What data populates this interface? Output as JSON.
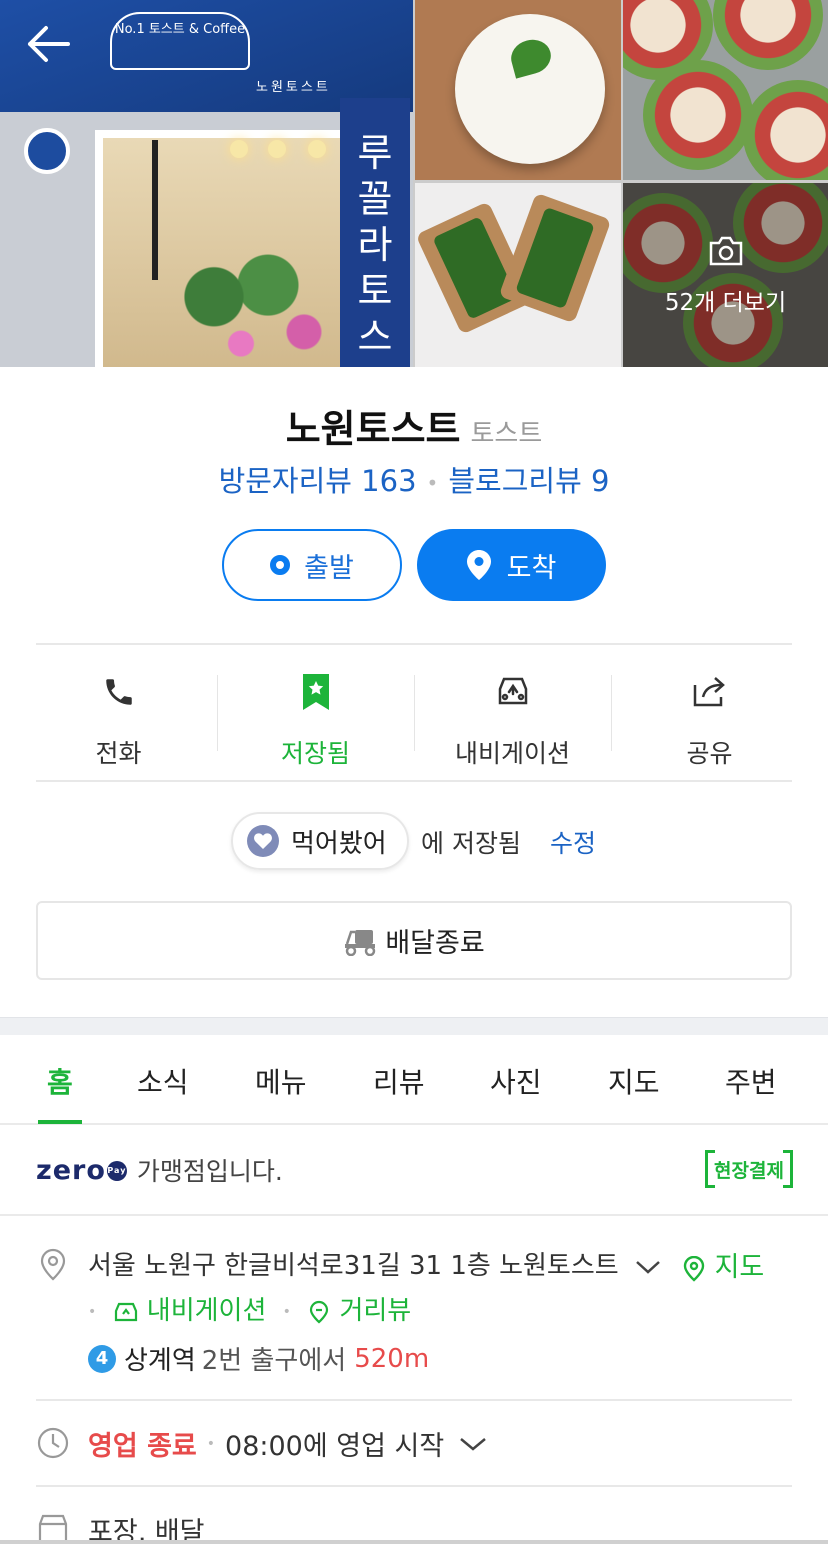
{
  "header": {
    "more_photos_label": "52개 더보기",
    "store_awning_text": "No.1 토스트 & Coffee",
    "store_awning_label": "노원토스트",
    "store_pillar_text": "루꼴라토스트"
  },
  "place": {
    "name": "노원토스트",
    "category": "토스트",
    "visitor_reviews": "방문자리뷰 163",
    "blog_reviews": "블로그리뷰 9"
  },
  "route": {
    "start_label": "출발",
    "end_label": "도착"
  },
  "actions": [
    {
      "label": "전화",
      "icon": "phone-icon"
    },
    {
      "label": "저장됨",
      "icon": "bookmark-star-icon"
    },
    {
      "label": "내비게이션",
      "icon": "car-navigation-icon"
    },
    {
      "label": "공유",
      "icon": "share-icon"
    }
  ],
  "saved_list": {
    "chip_label": "먹어봤어",
    "saved_text": "에 저장됨",
    "edit_label": "수정"
  },
  "delivery": {
    "label": "배달종료"
  },
  "tabs": [
    "홈",
    "소식",
    "메뉴",
    "리뷰",
    "사진",
    "지도",
    "주변"
  ],
  "zeropay": {
    "logo": "zero",
    "logo_badge": "Pay",
    "text": "가맹점입니다.",
    "onsite_label": "현장결제"
  },
  "address": {
    "text": "서울 노원구 한글비석로31길 31 1층 노원토스트",
    "map_label": "지도",
    "navigation_label": "내비게이션",
    "streetview_label": "거리뷰",
    "subway_line": "4",
    "subway_station": "상계역",
    "subway_exit": "2번 출구에서",
    "subway_distance": "520m"
  },
  "hours": {
    "status": "영업 종료",
    "next_open": "08:00에 영업 시작"
  },
  "services": {
    "text": "포장, 배달"
  },
  "colors": {
    "accent_green": "#1db43a",
    "accent_blue": "#0a7cf0",
    "link_blue": "#1b63c4",
    "alert_red": "#e74b4b"
  }
}
